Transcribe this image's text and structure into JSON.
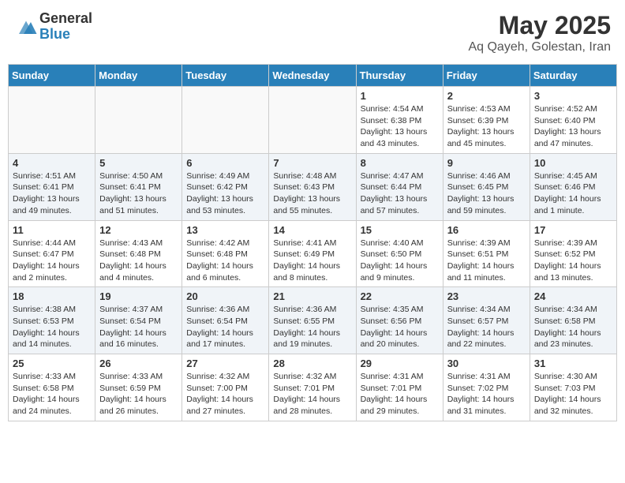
{
  "logo": {
    "general": "General",
    "blue": "Blue"
  },
  "header": {
    "month_title": "May 2025",
    "subtitle": "Aq Qayeh, Golestan, Iran"
  },
  "weekdays": [
    "Sunday",
    "Monday",
    "Tuesday",
    "Wednesday",
    "Thursday",
    "Friday",
    "Saturday"
  ],
  "weeks": [
    [
      {
        "day": "",
        "info": ""
      },
      {
        "day": "",
        "info": ""
      },
      {
        "day": "",
        "info": ""
      },
      {
        "day": "",
        "info": ""
      },
      {
        "day": "1",
        "info": "Sunrise: 4:54 AM\nSunset: 6:38 PM\nDaylight: 13 hours\nand 43 minutes."
      },
      {
        "day": "2",
        "info": "Sunrise: 4:53 AM\nSunset: 6:39 PM\nDaylight: 13 hours\nand 45 minutes."
      },
      {
        "day": "3",
        "info": "Sunrise: 4:52 AM\nSunset: 6:40 PM\nDaylight: 13 hours\nand 47 minutes."
      }
    ],
    [
      {
        "day": "4",
        "info": "Sunrise: 4:51 AM\nSunset: 6:41 PM\nDaylight: 13 hours\nand 49 minutes."
      },
      {
        "day": "5",
        "info": "Sunrise: 4:50 AM\nSunset: 6:41 PM\nDaylight: 13 hours\nand 51 minutes."
      },
      {
        "day": "6",
        "info": "Sunrise: 4:49 AM\nSunset: 6:42 PM\nDaylight: 13 hours\nand 53 minutes."
      },
      {
        "day": "7",
        "info": "Sunrise: 4:48 AM\nSunset: 6:43 PM\nDaylight: 13 hours\nand 55 minutes."
      },
      {
        "day": "8",
        "info": "Sunrise: 4:47 AM\nSunset: 6:44 PM\nDaylight: 13 hours\nand 57 minutes."
      },
      {
        "day": "9",
        "info": "Sunrise: 4:46 AM\nSunset: 6:45 PM\nDaylight: 13 hours\nand 59 minutes."
      },
      {
        "day": "10",
        "info": "Sunrise: 4:45 AM\nSunset: 6:46 PM\nDaylight: 14 hours\nand 1 minute."
      }
    ],
    [
      {
        "day": "11",
        "info": "Sunrise: 4:44 AM\nSunset: 6:47 PM\nDaylight: 14 hours\nand 2 minutes."
      },
      {
        "day": "12",
        "info": "Sunrise: 4:43 AM\nSunset: 6:48 PM\nDaylight: 14 hours\nand 4 minutes."
      },
      {
        "day": "13",
        "info": "Sunrise: 4:42 AM\nSunset: 6:48 PM\nDaylight: 14 hours\nand 6 minutes."
      },
      {
        "day": "14",
        "info": "Sunrise: 4:41 AM\nSunset: 6:49 PM\nDaylight: 14 hours\nand 8 minutes."
      },
      {
        "day": "15",
        "info": "Sunrise: 4:40 AM\nSunset: 6:50 PM\nDaylight: 14 hours\nand 9 minutes."
      },
      {
        "day": "16",
        "info": "Sunrise: 4:39 AM\nSunset: 6:51 PM\nDaylight: 14 hours\nand 11 minutes."
      },
      {
        "day": "17",
        "info": "Sunrise: 4:39 AM\nSunset: 6:52 PM\nDaylight: 14 hours\nand 13 minutes."
      }
    ],
    [
      {
        "day": "18",
        "info": "Sunrise: 4:38 AM\nSunset: 6:53 PM\nDaylight: 14 hours\nand 14 minutes."
      },
      {
        "day": "19",
        "info": "Sunrise: 4:37 AM\nSunset: 6:54 PM\nDaylight: 14 hours\nand 16 minutes."
      },
      {
        "day": "20",
        "info": "Sunrise: 4:36 AM\nSunset: 6:54 PM\nDaylight: 14 hours\nand 17 minutes."
      },
      {
        "day": "21",
        "info": "Sunrise: 4:36 AM\nSunset: 6:55 PM\nDaylight: 14 hours\nand 19 minutes."
      },
      {
        "day": "22",
        "info": "Sunrise: 4:35 AM\nSunset: 6:56 PM\nDaylight: 14 hours\nand 20 minutes."
      },
      {
        "day": "23",
        "info": "Sunrise: 4:34 AM\nSunset: 6:57 PM\nDaylight: 14 hours\nand 22 minutes."
      },
      {
        "day": "24",
        "info": "Sunrise: 4:34 AM\nSunset: 6:58 PM\nDaylight: 14 hours\nand 23 minutes."
      }
    ],
    [
      {
        "day": "25",
        "info": "Sunrise: 4:33 AM\nSunset: 6:58 PM\nDaylight: 14 hours\nand 24 minutes."
      },
      {
        "day": "26",
        "info": "Sunrise: 4:33 AM\nSunset: 6:59 PM\nDaylight: 14 hours\nand 26 minutes."
      },
      {
        "day": "27",
        "info": "Sunrise: 4:32 AM\nSunset: 7:00 PM\nDaylight: 14 hours\nand 27 minutes."
      },
      {
        "day": "28",
        "info": "Sunrise: 4:32 AM\nSunset: 7:01 PM\nDaylight: 14 hours\nand 28 minutes."
      },
      {
        "day": "29",
        "info": "Sunrise: 4:31 AM\nSunset: 7:01 PM\nDaylight: 14 hours\nand 29 minutes."
      },
      {
        "day": "30",
        "info": "Sunrise: 4:31 AM\nSunset: 7:02 PM\nDaylight: 14 hours\nand 31 minutes."
      },
      {
        "day": "31",
        "info": "Sunrise: 4:30 AM\nSunset: 7:03 PM\nDaylight: 14 hours\nand 32 minutes."
      }
    ]
  ]
}
